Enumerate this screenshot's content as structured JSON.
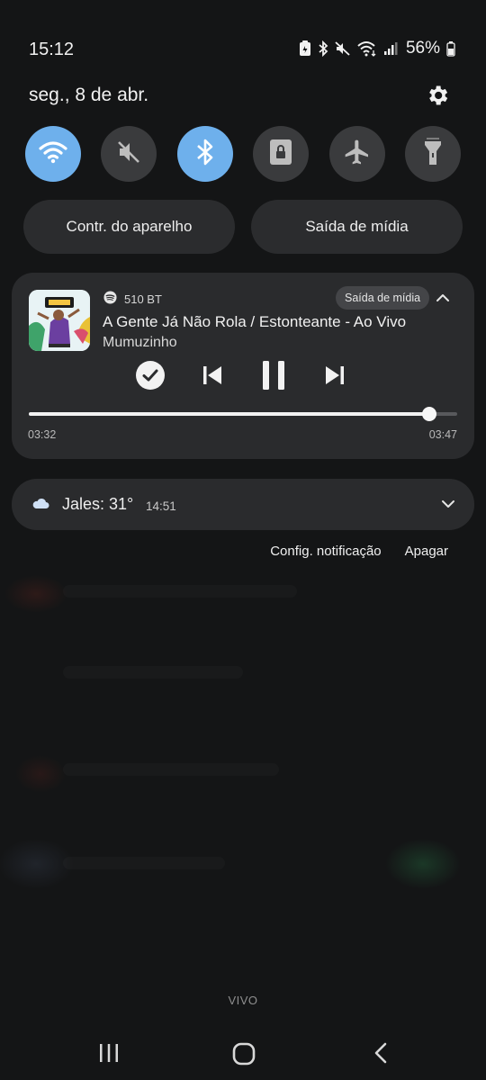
{
  "status_bar": {
    "time": "15:12",
    "battery_percent": "56%"
  },
  "header": {
    "date": "seg., 8 de abr."
  },
  "quick_toggles": [
    {
      "name": "wifi",
      "icon": "wifi-icon",
      "active": true
    },
    {
      "name": "sound",
      "icon": "mute-icon",
      "active": false
    },
    {
      "name": "bluetooth",
      "icon": "bluetooth-icon",
      "active": true
    },
    {
      "name": "portrait-lock",
      "icon": "lock-icon",
      "active": false
    },
    {
      "name": "airplane",
      "icon": "airplane-icon",
      "active": false
    },
    {
      "name": "flashlight",
      "icon": "flashlight-icon",
      "active": false
    }
  ],
  "pills": {
    "device_control": "Contr. do aparelho",
    "media_output": "Saída de mídia"
  },
  "media": {
    "source_app": "spotify-icon",
    "device": "510 BT",
    "output_chip": "Saída de mídia",
    "title": "A Gente Já Não Rola / Estonteante - Ao Vivo",
    "artist": "Mumuzinho",
    "elapsed": "03:32",
    "total": "03:47",
    "progress_fraction": 0.934
  },
  "weather": {
    "text": "Jales: 31°",
    "time": "14:51"
  },
  "notification_actions": {
    "settings": "Config. notificação",
    "clear": "Apagar"
  },
  "carrier": "VIVO",
  "colors": {
    "accent_on": "#6eb0ec",
    "card_bg": "#2a2b2d",
    "background": "#141516"
  }
}
